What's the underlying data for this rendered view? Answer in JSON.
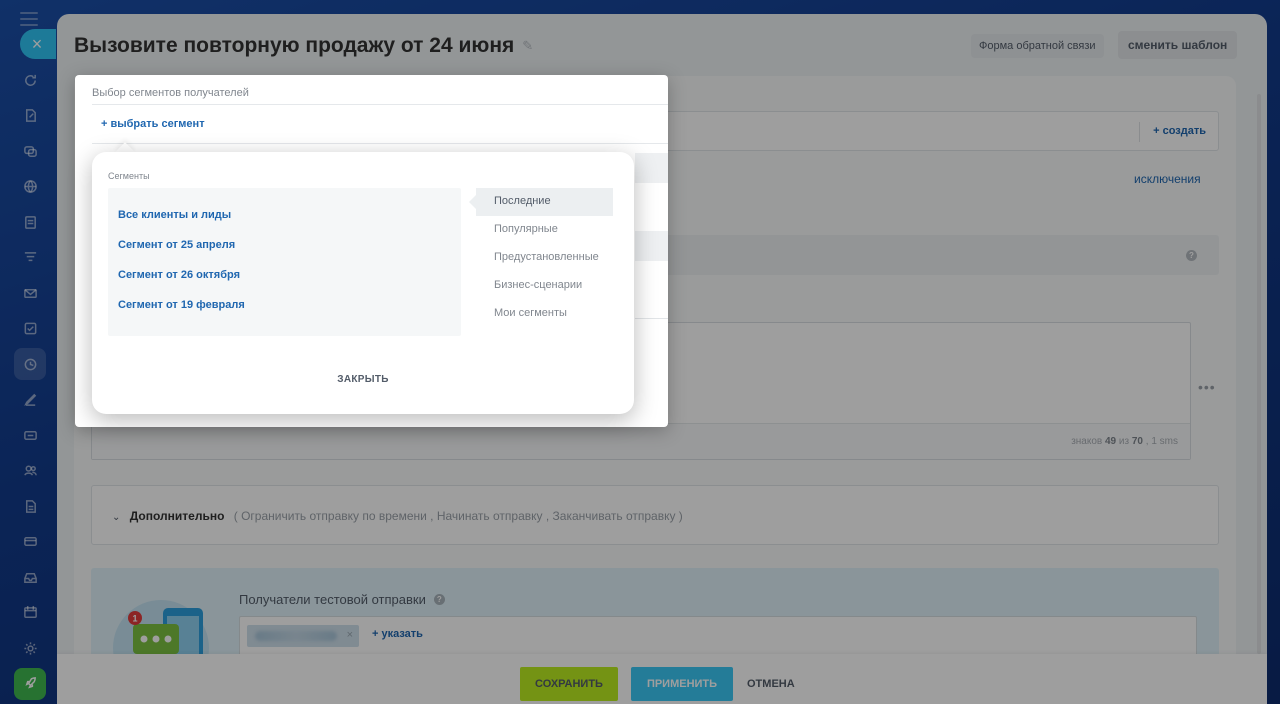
{
  "page": {
    "title": "Вызовите повторную продажу от 24 июня",
    "feedback_button": "Форма обратной связи",
    "template_button": "сменить шаблон"
  },
  "sidebar": {
    "close_label": "×",
    "icons": [
      "refresh-icon",
      "document-edit-icon",
      "chat-icon",
      "globe-icon",
      "notes-icon",
      "filter-icon",
      "mail-icon",
      "checkbox-icon",
      "marketing-icon",
      "pen-icon",
      "ticket-icon",
      "people-icon",
      "document-icon",
      "card-icon",
      "inbox-icon",
      "calendar-icon",
      "gear-icon",
      "rocket-icon"
    ]
  },
  "form": {
    "create_link": "+ создать",
    "exclusions_link": "исключения",
    "char_count_prefix": "знаков ",
    "char_count_value": "49",
    "char_count_of": " из ",
    "char_count_max": "70",
    "char_count_suffix": " , 1 sms",
    "more_dots": "•••",
    "extra_label": "Дополнительно",
    "extra_options": "( Ограничить отправку по времени ,  Начинать отправку ,  Заканчивать отправку )",
    "test_label": "Получатели тестовой отправки",
    "test_add_link": "+ указать",
    "notification_badge": "1"
  },
  "footer": {
    "save": "СОХРАНИТЬ",
    "apply": "ПРИМЕНИТЬ",
    "cancel": "ОТМЕНА"
  },
  "segment_picker": {
    "label": "Выбор сегментов получателей",
    "select_link": "+ выбрать сегмент"
  },
  "segments_popup": {
    "title": "Сегменты",
    "segments": [
      "Все клиенты и лиды",
      "Сегмент от 25 апреля",
      "Сегмент от 26 октября",
      "Сегмент от 19 февраля"
    ],
    "categories": [
      "Последние",
      "Популярные",
      "Предустановленные",
      "Бизнес-сценарии",
      "Мои сегменты"
    ],
    "active_category": "Последние",
    "close": "ЗАКРЫТЬ"
  },
  "colors": {
    "accent_blue": "#2067b0",
    "save_green": "#bbed21",
    "apply_cyan": "#3bc8f5",
    "close_cyan": "#2fc6f6"
  }
}
